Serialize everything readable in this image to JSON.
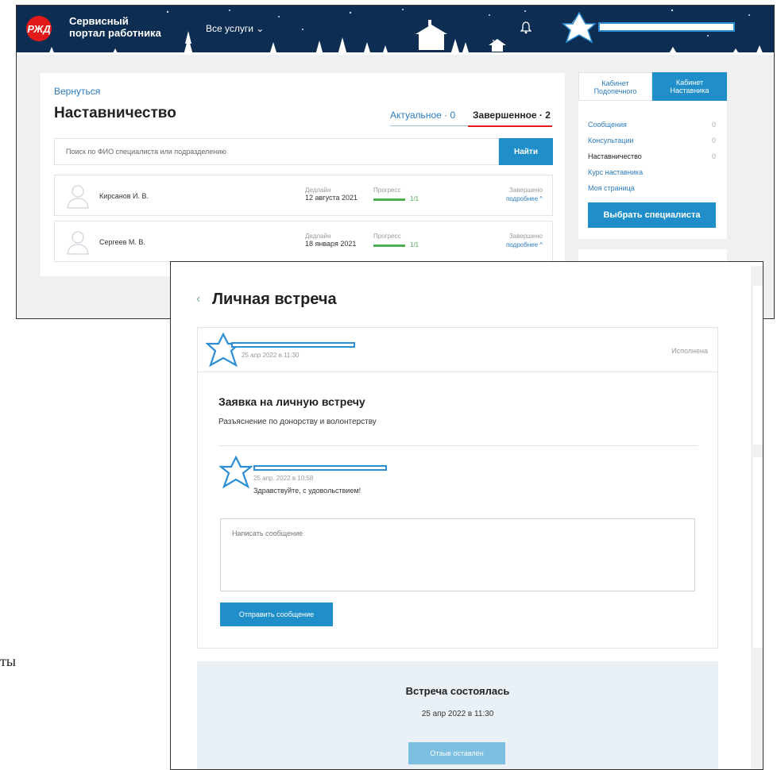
{
  "portal": {
    "logo": "РЖД",
    "title_line1": "Сервисный",
    "title_line2": "портал работника",
    "services_menu": "Все услуги ⌄",
    "back_link": "Вернуться",
    "page_title": "Наставничество",
    "tabs": {
      "current": "Актуальное · 0",
      "completed": "Завершенное · 2"
    },
    "search": {
      "placeholder": "Поиск по ФИО специалиста или подразделению",
      "button": "Найти"
    },
    "mentees": [
      {
        "name": "Кирсанов И. В.",
        "deadline_label": "Дедлайн",
        "deadline": "12 августа 2021",
        "progress_label": "Прогресс",
        "progress": "1/1",
        "status": "Завершено",
        "more": "подробнее ^"
      },
      {
        "name": "Сергеев М. В.",
        "deadline_label": "Дедлайн",
        "deadline": "18 января 2021",
        "progress_label": "Прогресс",
        "progress": "1/1",
        "status": "Завершено",
        "more": "подробнее ^"
      }
    ],
    "right_panel": {
      "tab_mentee_1": "Кабинет",
      "tab_mentee_2": "Подопечного",
      "tab_mentor_1": "Кабинет",
      "tab_mentor_2": "Наставника",
      "items": [
        {
          "label": "Сообщения",
          "count": "0"
        },
        {
          "label": "Консультации",
          "count": "0"
        },
        {
          "label": "Наставничество",
          "count": "0"
        },
        {
          "label": "Курс наставника",
          "count": ""
        },
        {
          "label": "Моя страница",
          "count": ""
        }
      ],
      "button": "Выбрать специалиста"
    }
  },
  "meeting": {
    "back_icon": "‹",
    "title": "Личная встреча",
    "date": "25 апр 2022 в 11:30",
    "status": "Исполнена",
    "request_title": "Заявка на личную встречу",
    "request_subtitle": "Разъяснение по донорству и волонтерству",
    "message": {
      "date": "25 апр. 2022 в 10:58",
      "text": "Здравствуйте, с удовольствием!"
    },
    "input_placeholder": "Написать сообщение",
    "send_button": "Отправить сообщение",
    "outcome": {
      "title": "Встреча состоялась",
      "date": "25 апр 2022 в 11:30",
      "button": "Отзыв оставлен"
    }
  },
  "stray_text": "ты"
}
